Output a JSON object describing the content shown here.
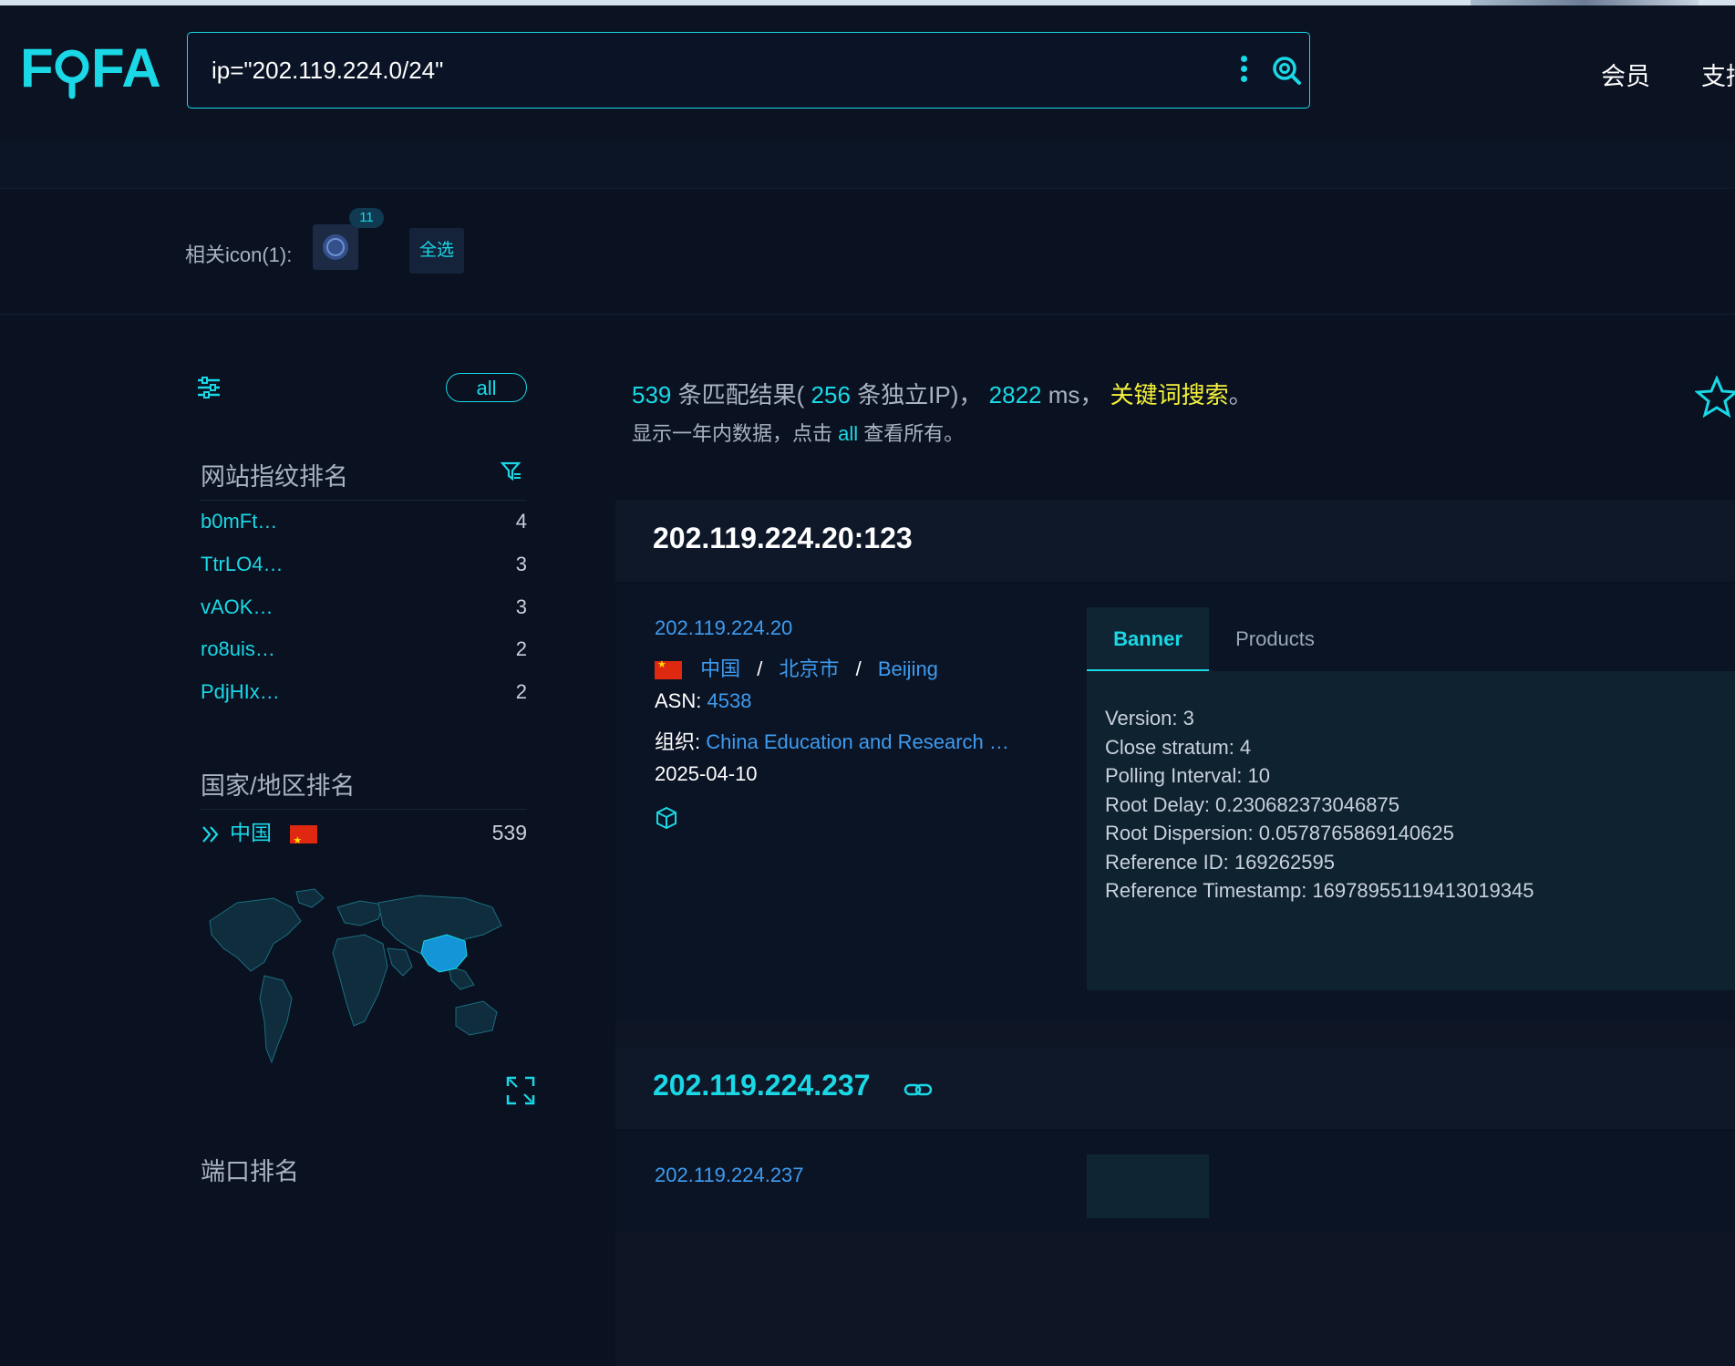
{
  "header": {
    "logo": "FOFA",
    "search_value": "ip=\"202.119.224.0/24\"",
    "nav_member": "会员",
    "nav_support": "支持"
  },
  "icon_bar": {
    "label": "相关icon(1):",
    "icon_count": "11",
    "select_all": "全选"
  },
  "sidebar": {
    "all_label": "all",
    "fingerprint_title": "网站指纹排名",
    "fingerprints": [
      {
        "name": "b0mFt…",
        "count": "4"
      },
      {
        "name": "TtrLO4…",
        "count": "3"
      },
      {
        "name": "vAOK…",
        "count": "3"
      },
      {
        "name": "ro8uis…",
        "count": "2"
      },
      {
        "name": "PdjHIx…",
        "count": "2"
      }
    ],
    "country_title": "国家/地区排名",
    "countries": [
      {
        "name": "中国",
        "count": "539"
      }
    ],
    "port_title": "端口排名"
  },
  "summary": {
    "matches": "539",
    "matches_label": "条匹配结果",
    "paren_open": "(",
    "unique_ips": "256",
    "unique_label": "条独立IP",
    "paren_close": ")，",
    "ms": "2822",
    "ms_label": "ms，",
    "keyword_search": "关键词搜索",
    "period": "。",
    "note_prefix": "显示一年内数据，点击",
    "note_link": "all",
    "note_suffix": "查看所有。"
  },
  "results": [
    {
      "host": "202.119.224.20:123",
      "ip": "202.119.224.20",
      "country": "中国",
      "region": "北京市",
      "city": "Beijing",
      "asn_label": "ASN:",
      "asn": "4538",
      "org_label": "组织:",
      "org": "China Education and Research …",
      "date": "2025-04-10",
      "tabs": [
        "Banner",
        "Products"
      ],
      "banner": "Version: 3\nClose stratum: 4\nPolling Interval: 10\nRoot Delay: 0.230682373046875\nRoot Dispersion: 0.0578765869140625\nReference ID: 169262595\nReference Timestamp: 16978955119413019345"
    },
    {
      "host": "202.119.224.237",
      "ip": "202.119.224.237"
    }
  ],
  "colors": {
    "accent": "#1ad8e6",
    "link": "#3e9bf0",
    "keyword": "#f5f23b",
    "background": "#0a1120"
  }
}
